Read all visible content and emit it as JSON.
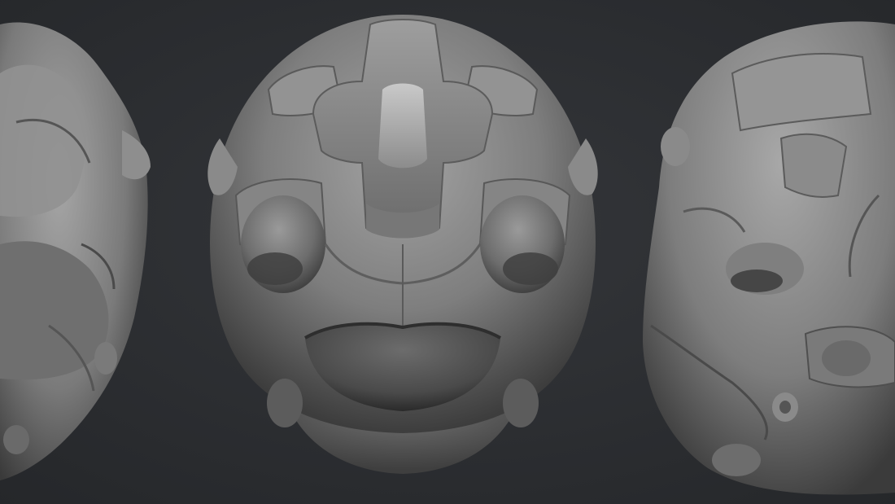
{
  "image": {
    "subject": "",
    "background_color": "#2b2d30",
    "material_color": "#8a8a8a"
  }
}
